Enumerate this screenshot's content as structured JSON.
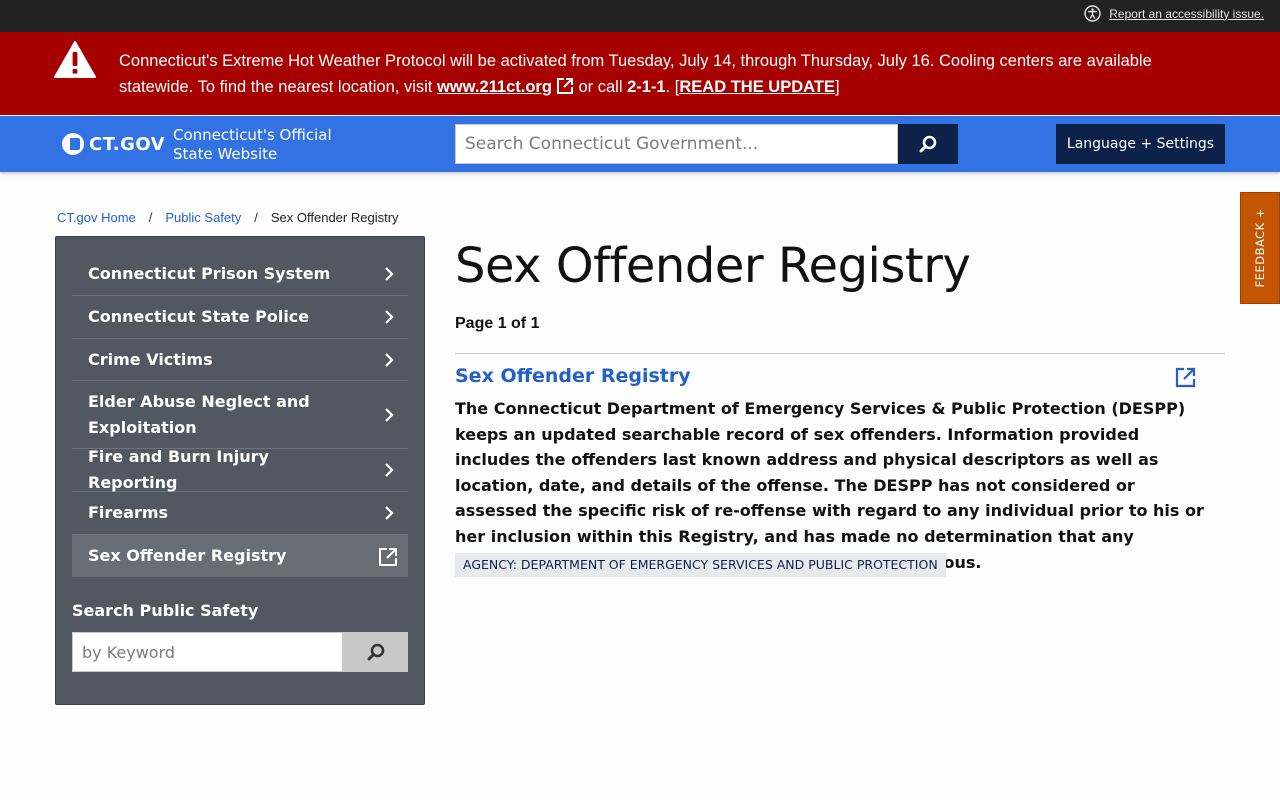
{
  "utility": {
    "a11y_link": "Report an accessibility issue."
  },
  "alert": {
    "text_before": "Connecticut's Extreme Hot Weather Protocol will be activated from Tuesday, July 14, through Thursday, July 16. Cooling centers are available statewide. To find the nearest location, visit ",
    "link_211": "www.211ct.org",
    "text_call": " or call ",
    "phone": "2-1-1",
    "text_bracket_open": ". [",
    "update_link": "READ THE UPDATE",
    "text_bracket_close": "]"
  },
  "header": {
    "logo_text": "CT.GOV",
    "tagline": "Connecticut's Official State Website",
    "search_placeholder": "Search Connecticut Government...",
    "language_button": "Language + Settings"
  },
  "feedback": {
    "label": "FEEDBACK +"
  },
  "breadcrumb": {
    "items": [
      "CT.gov Home",
      "Public Safety",
      "Sex Offender Registry"
    ],
    "separator": "/"
  },
  "sidebar": {
    "items": [
      {
        "label": "Connecticut Prison System",
        "icon": "chevron-right-icon"
      },
      {
        "label": "Connecticut State Police",
        "icon": "chevron-right-icon"
      },
      {
        "label": "Crime Victims",
        "icon": "chevron-right-icon"
      },
      {
        "label": "Elder Abuse Neglect and Exploitation",
        "icon": "chevron-right-icon"
      },
      {
        "label": "Fire and Burn Injury Reporting",
        "icon": "chevron-right-icon"
      },
      {
        "label": "Firearms",
        "icon": "chevron-right-icon"
      },
      {
        "label": "Sex Offender Registry",
        "icon": "external-link-icon",
        "active": true
      }
    ],
    "search_title": "Search Public Safety",
    "search_placeholder": "by Keyword"
  },
  "main": {
    "title": "Sex Offender Registry",
    "page_count": "Page 1 of 1",
    "result": {
      "title": "Sex Offender Registry",
      "description": "The Connecticut Department of Emergency Services & Public Protection (DESPP) keeps an updated searchable record of sex offenders. Information provided includes the offenders last known address and physical descriptors as well as location, date, and details of the offense. The DESPP has not considered or assessed the specific risk of re-offense with regard to any individual prior to his or her inclusion within this Registry, and has made no determination that any individual included in the Registry is currently dangerous.",
      "agency": "AGENCY: DEPARTMENT OF EMERGENCY SERVICES AND PUBLIC PROTECTION"
    }
  },
  "colors": {
    "topbar": "#222222",
    "alert": "#a70000",
    "header": "#3272e2",
    "navy": "#0d2249",
    "sidebar": "#525861",
    "link": "#2361c8",
    "feedback": "#c45500"
  }
}
